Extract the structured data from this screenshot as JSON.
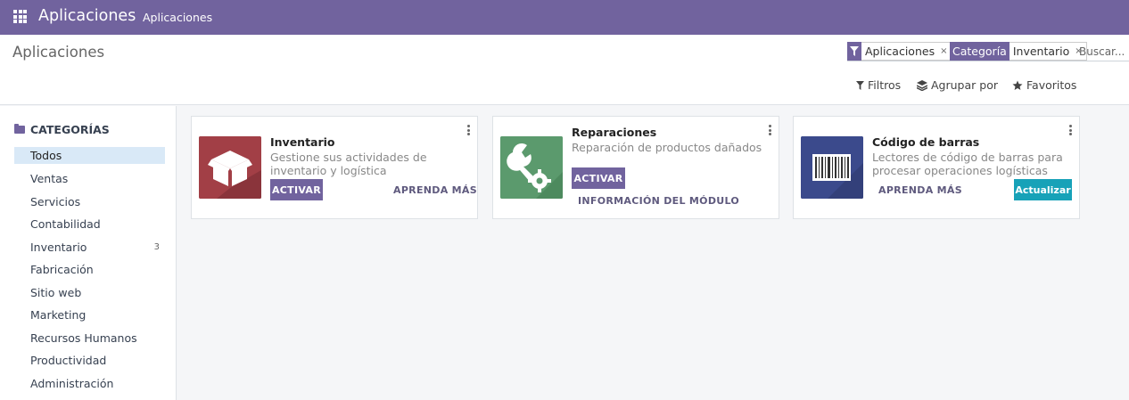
{
  "navbar": {
    "brand": "Aplicaciones",
    "menu_item": "Aplicaciones"
  },
  "control_panel": {
    "title": "Aplicaciones",
    "search": {
      "facets": [
        {
          "label": "",
          "value": "Aplicaciones",
          "icon": "filter-icon"
        },
        {
          "label": "Categoría",
          "value": "Inventario"
        }
      ],
      "close_glyph": "×",
      "placeholder": "Buscar..."
    },
    "buttons": {
      "filters": "Filtros",
      "group_by": "Agrupar por",
      "favorites": "Favoritos"
    }
  },
  "sidebar": {
    "header": "CATEGORÍAS",
    "items": [
      {
        "label": "Todos",
        "active": true
      },
      {
        "label": "Ventas"
      },
      {
        "label": "Servicios"
      },
      {
        "label": "Contabilidad"
      },
      {
        "label": "Inventario",
        "count": "3"
      },
      {
        "label": "Fabricación"
      },
      {
        "label": "Sitio web"
      },
      {
        "label": "Marketing"
      },
      {
        "label": "Recursos Humanos"
      },
      {
        "label": "Productividad"
      },
      {
        "label": "Administración"
      }
    ]
  },
  "apps": [
    {
      "name": "Inventario",
      "summary": "Gestione sus actividades de inventario y logística",
      "activate_label": "ACTIVAR",
      "learn_more_label": "APRENDA MÁS",
      "icon": "box-icon",
      "icon_color": "#a23f46"
    },
    {
      "name": "Reparaciones",
      "summary": "Reparación de productos dañados",
      "activate_label": "ACTIVAR",
      "module_info_label": "INFORMACIÓN DEL MÓDULO",
      "icon": "wrench-gear-icon",
      "icon_color": "#5b9a6d"
    },
    {
      "name": "Código de barras",
      "summary": "Lectores de código de barras para procesar operaciones logísticas",
      "learn_more_label": "APRENDA MÁS",
      "update_label": "Actualizar",
      "icon": "barcode-icon",
      "icon_color": "#3b4a8c"
    }
  ],
  "colors": {
    "brand": "#71639e",
    "update_button": "#17a2b8",
    "active_category": "#d9e9f7"
  }
}
